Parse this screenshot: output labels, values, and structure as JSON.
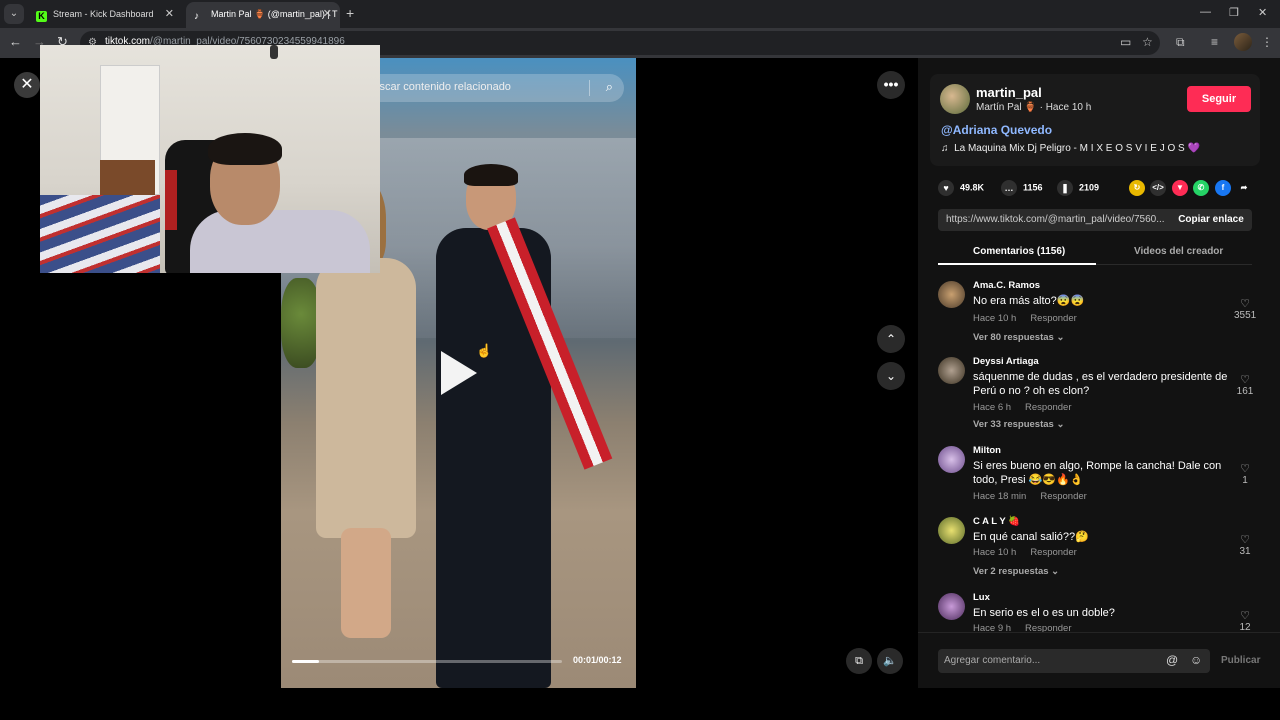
{
  "browser": {
    "tabs": [
      {
        "title": "Stream - Kick Dashboard",
        "icon": "kick-icon"
      },
      {
        "title": "Martin Pal 🏺 (@martin_pal) | T",
        "icon": "tiktok-icon"
      }
    ],
    "url_domain": "tiktok.com",
    "url_path": "/@martin_pal/video/7560730234559941896"
  },
  "video": {
    "search_placeholder": "Buscar contenido relacionado",
    "time": "00:01/00:12",
    "progress": 0.1
  },
  "author": {
    "username": "martin_pal",
    "display": "Martín Pal 🏺",
    "posted": "· Hace 10 h",
    "follow_label": "Seguir",
    "mention": "@Adriana Quevedo",
    "music": "La Maquina Mix Dj Peligro - M I X E O S V I E J O S 💜"
  },
  "stats": {
    "likes": "49.8K",
    "comments": "1156",
    "saves": "2109"
  },
  "link": {
    "url": "https://www.tiktok.com/@martin_pal/video/7560...",
    "copy_label": "Copiar enlace"
  },
  "comment_tabs": {
    "comments": "Comentarios (1156)",
    "creator_videos": "Videos del creador"
  },
  "comments": [
    {
      "user": "Ama.C. Ramos",
      "text": "No era más alto?😨😨",
      "time": "Hace 10 h",
      "reply": "Responder",
      "likes": "3551",
      "more": "Ver 80 respuestas ⌄"
    },
    {
      "user": "Deyssi Artiaga",
      "text": "sáquenme de dudas , es el verdadero presidente de Perú o no ? oh es clon?",
      "time": "Hace 6 h",
      "reply": "Responder",
      "likes": "161",
      "more": "Ver 33 respuestas ⌄"
    },
    {
      "user": "Milton",
      "text": "Si eres bueno en algo, Rompe la cancha! Dale con todo, Presi 😂😎🔥👌",
      "time": "Hace 18 min",
      "reply": "Responder",
      "likes": "1",
      "more": ""
    },
    {
      "user": "C A L Y 🍓",
      "text": "En qué canal salió??🤔",
      "time": "Hace 10 h",
      "reply": "Responder",
      "likes": "31",
      "more": "Ver 2 respuestas ⌄"
    },
    {
      "user": "Lux",
      "text": "En serio es el o es un doble?",
      "time": "Hace 9 h",
      "reply": "Responder",
      "likes": "12",
      "more": ""
    }
  ],
  "compose": {
    "placeholder": "Agregar comentario...",
    "post_label": "Publicar"
  }
}
